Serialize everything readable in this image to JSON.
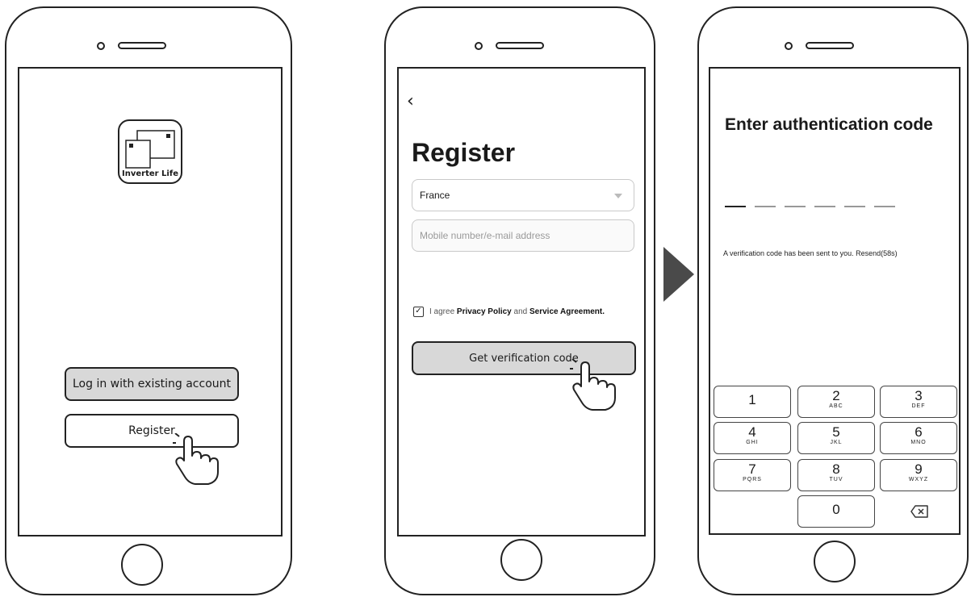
{
  "phone1": {
    "app_name": "Inverter Life",
    "login_button": "Log in with existing account",
    "register_button": "Register"
  },
  "phone2": {
    "back_icon": "chevron-left-icon",
    "title": "Register",
    "country_value": "France",
    "contact_placeholder": "Mobile number/e-mail address",
    "agree_prefix": "I agree",
    "privacy_link": "Privacy Policy",
    "agree_and": "and",
    "service_link": "Service Agreement.",
    "checkbox_checked": true,
    "verification_button": "Get verification code"
  },
  "phone3": {
    "title": "Enter authentication code",
    "code_slots": 6,
    "message": "A verification code has been sent to you. Resend(58s)",
    "keypad": [
      {
        "num": "1",
        "sub": ""
      },
      {
        "num": "2",
        "sub": "ABC"
      },
      {
        "num": "3",
        "sub": "DEF"
      },
      {
        "num": "4",
        "sub": "GHI"
      },
      {
        "num": "5",
        "sub": "JKL"
      },
      {
        "num": "6",
        "sub": "MNO"
      },
      {
        "num": "7",
        "sub": "PQRS"
      },
      {
        "num": "8",
        "sub": "TUV"
      },
      {
        "num": "9",
        "sub": "WXYZ"
      },
      {
        "num": "0",
        "sub": ""
      }
    ],
    "backspace_icon": "backspace-icon"
  },
  "colors": {
    "button_grey": "#d8d8d8",
    "arrow": "#4a4a4a",
    "outline": "#222222"
  }
}
